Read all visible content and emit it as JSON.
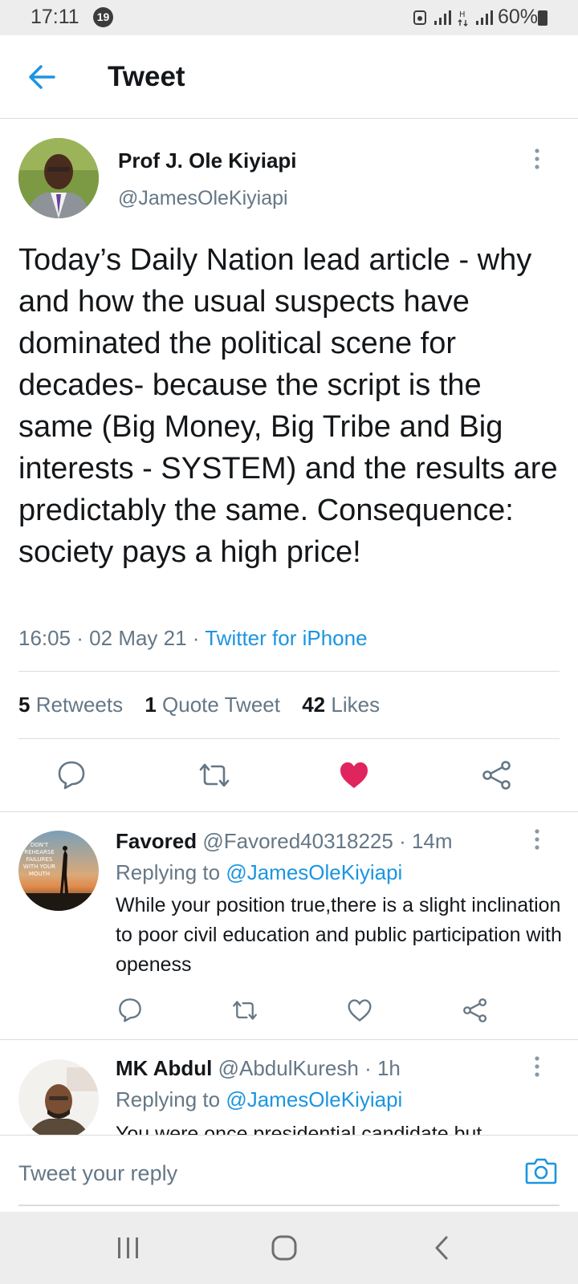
{
  "status_bar": {
    "time": "17:11",
    "notification_count": "19",
    "battery_text": "60%"
  },
  "header": {
    "title": "Tweet"
  },
  "tweet": {
    "author_name": "Prof J. Ole Kiyiapi",
    "author_handle": "@JamesOleKiyiapi",
    "text": "Today’s Daily Nation lead article - why and how the usual suspects have dominated the political scene for decades- because the script is the same (Big Money, Big Tribe and Big interests - SYSTEM) and the results are predictably the same. Consequence: society pays a high price!",
    "timestamp": "16:05 · 02 May 21 · ",
    "source": "Twitter for iPhone",
    "stats": {
      "retweets_count": "5",
      "retweets_label": "Retweets",
      "quotes_count": "1",
      "quotes_label": "Quote Tweet",
      "likes_count": "42",
      "likes_label": "Likes"
    },
    "liked": true
  },
  "replies": [
    {
      "name": "Favored",
      "handle": "@Favored40318225",
      "time": " · 14m",
      "replying_label": "Replying to ",
      "replying_to": "@JamesOleKiyiapi",
      "text": "While your position true,there is a slight inclination to poor civil education and public participation with openess",
      "avatar_text": "DON'T REHEARSE FAILURES WITH YOUR MOUTH"
    },
    {
      "name": "MK Abdul",
      "handle": "@AbdulKuresh",
      "time": " · 1h",
      "replying_label": "Replying to ",
      "replying_to": "@JamesOleKiyiapi",
      "text": "You were once presidential candidate but"
    }
  ],
  "composer": {
    "placeholder": "Tweet your reply"
  },
  "colors": {
    "accent": "#1b95e0",
    "like": "#e0245e",
    "text_secondary": "#657786"
  },
  "icons": [
    "back-arrow-icon",
    "more-icon",
    "reply-icon",
    "retweet-icon",
    "heart-icon",
    "share-icon",
    "camera-icon",
    "recents-icon",
    "home-icon",
    "back-icon"
  ]
}
